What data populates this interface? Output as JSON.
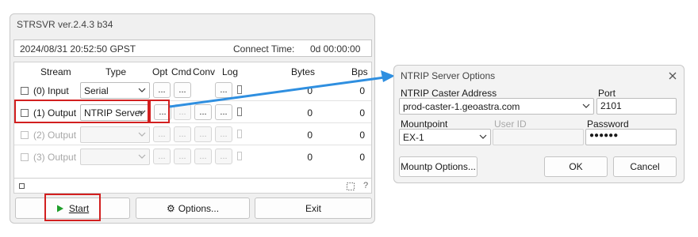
{
  "strsvr": {
    "title": "STRSVR ver.2.4.3 b34",
    "datetime": "2024/08/31 20:52:50 GPST",
    "connect_label": "Connect Time:",
    "connect_value": "0d 00:00:00",
    "headers": {
      "stream": "Stream",
      "type": "Type",
      "opt": "Opt",
      "cmd": "Cmd",
      "conv": "Conv",
      "log": "Log",
      "bytes": "Bytes",
      "bps": "Bps"
    },
    "rows": [
      {
        "checked": false,
        "label": "(0) Input",
        "type": "Serial",
        "bytes": "0",
        "bps": "0",
        "enabled": true
      },
      {
        "checked": false,
        "label": "(1) Output",
        "type": "NTRIP Server",
        "bytes": "0",
        "bps": "0",
        "enabled": true
      },
      {
        "checked": false,
        "label": "(2) Output",
        "type": "",
        "bytes": "0",
        "bps": "0",
        "enabled": false
      },
      {
        "checked": false,
        "label": "(3) Output",
        "type": "",
        "bytes": "0",
        "bps": "0",
        "enabled": false
      }
    ],
    "ellipsis": "...",
    "status_help": "?",
    "start_label": "Start",
    "options_label": "Options...",
    "exit_label": "Exit",
    "start_icon": "play-icon",
    "options_icon": "gear-icon",
    "colors": {
      "highlight": "#d21f1f",
      "arrow": "#2f8fe0",
      "play": "#1e9e2a"
    }
  },
  "ntrip": {
    "title": "NTRIP Server Options",
    "caster_label": "NTRIP Caster Address",
    "caster_value": "prod-caster-1.geoastra.com",
    "port_label": "Port",
    "port_value": "2101",
    "mountpoint_label": "Mountpoint",
    "mountpoint_value": "EX-1",
    "userid_label": "User ID",
    "userid_value": "",
    "password_label": "Password",
    "password_value": "●●●●●●",
    "mountp_options_label": "Mountp Options...",
    "ok_label": "OK",
    "cancel_label": "Cancel",
    "close_icon": "close-icon"
  }
}
